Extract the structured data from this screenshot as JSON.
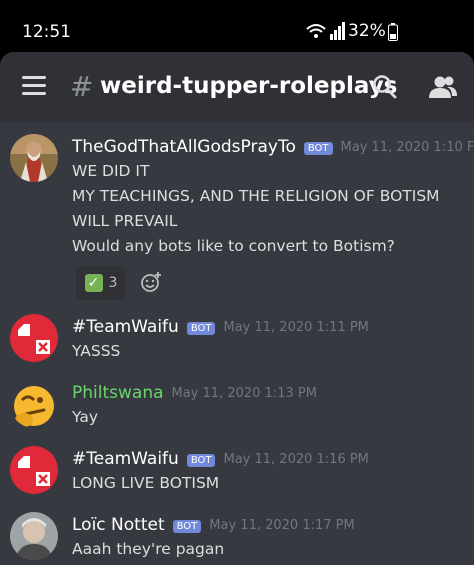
{
  "status_bar": {
    "time": "12:51",
    "battery": "32%"
  },
  "header": {
    "hash": "#",
    "channel": "weird-tupper-roleplays"
  },
  "messages": [
    {
      "author": "TheGodThatAllGodsPrayTo",
      "badge": "BOT",
      "timestamp": "May 11, 2020 1:10 F",
      "lines": [
        "WE DID IT",
        "MY TEACHINGS, AND THE RELIGION OF BOTISM",
        "WILL PREVAIL",
        "Would any bots like to convert to Botism?"
      ],
      "reaction": {
        "icon": "check-mark-icon",
        "count": "3"
      }
    },
    {
      "author": "#TeamWaifu",
      "badge": "BOT",
      "timestamp": "May 11, 2020 1:11 PM",
      "lines": [
        "YASSS"
      ]
    },
    {
      "author": "Philtswana",
      "timestamp": "May 11, 2020 1:13 PM",
      "lines": [
        "Yay"
      ],
      "author_color": "#6bd46b"
    },
    {
      "author": "#TeamWaifu",
      "badge": "BOT",
      "timestamp": "May 11, 2020 1:16 PM",
      "lines": [
        "LONG LIVE BOTISM"
      ]
    },
    {
      "author": "Loïc Nottet",
      "badge": "BOT",
      "timestamp": "May 11, 2020 1:17 PM",
      "lines": [
        "Aaah they're pagan"
      ]
    }
  ],
  "colors": {
    "background": "#36393f",
    "header": "#2f3136",
    "bot_badge": "#7289da",
    "timestamp": "#72767d"
  }
}
